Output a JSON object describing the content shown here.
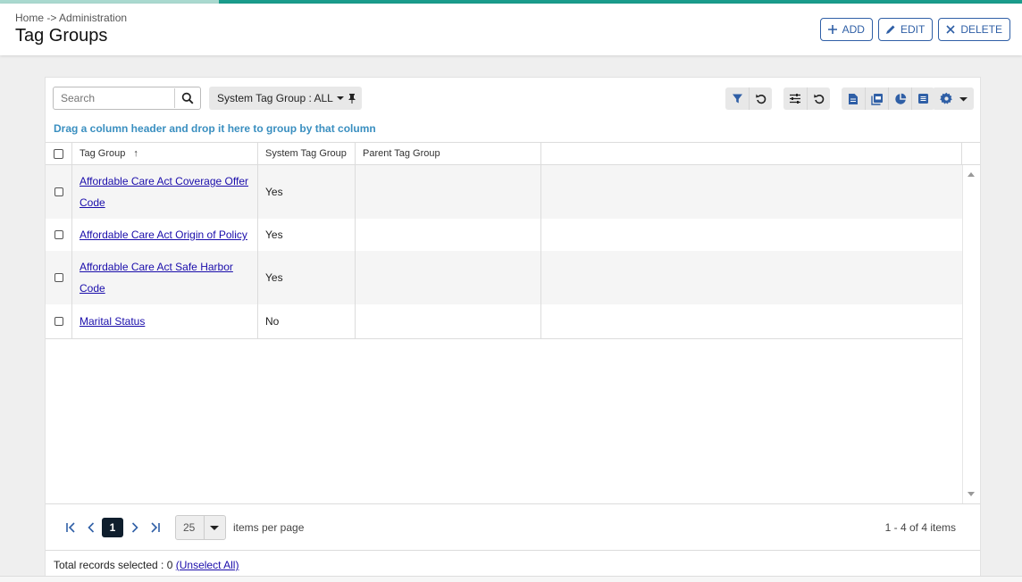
{
  "header": {
    "breadcrumb": "Home -> Administration",
    "title": "Tag Groups",
    "add_label": "ADD",
    "edit_label": "EDIT",
    "delete_label": "DELETE"
  },
  "toolbar": {
    "search_placeholder": "Search",
    "filter_chip": "System Tag Group : ALL"
  },
  "grid": {
    "drag_hint": "Drag a column header and drop it here to group by that column",
    "columns": [
      "Tag Group",
      "System Tag Group",
      "Parent Tag Group"
    ],
    "sort_indicator": "↑",
    "rows": [
      {
        "tag_group_line1": "Affordable Care Act Coverage Offer",
        "tag_group_line2": "Code",
        "system": "Yes",
        "parent": ""
      },
      {
        "tag_group_line1": "Affordable Care Act Origin of Policy",
        "tag_group_line2": "",
        "system": "Yes",
        "parent": ""
      },
      {
        "tag_group_line1": "Affordable Care Act Safe Harbor",
        "tag_group_line2": "Code",
        "system": "Yes",
        "parent": ""
      },
      {
        "tag_group_line1": "Marital Status",
        "tag_group_line2": "",
        "system": "No",
        "parent": ""
      }
    ]
  },
  "pager": {
    "current_page": "1",
    "page_size": "25",
    "items_per_page_label": "items per page",
    "summary": "1 - 4 of 4 items"
  },
  "selection": {
    "label": "Total records selected : 0",
    "unselect_label": "(Unselect All)"
  },
  "colors": {
    "accent_blue": "#2f5fa6",
    "link": "#1a0dab",
    "hint": "#3a8fc0",
    "top_bar": "#1a9c8c"
  },
  "icons": [
    "plus-icon",
    "pencil-icon",
    "close-icon",
    "search-icon",
    "caret-down-icon",
    "pin-icon",
    "filter-icon",
    "reset-icon",
    "sliders-icon",
    "document-icon",
    "pdf-icon",
    "pie-chart-icon",
    "list-doc-icon",
    "gear-icon",
    "first-page-icon",
    "prev-page-icon",
    "next-page-icon",
    "last-page-icon"
  ]
}
